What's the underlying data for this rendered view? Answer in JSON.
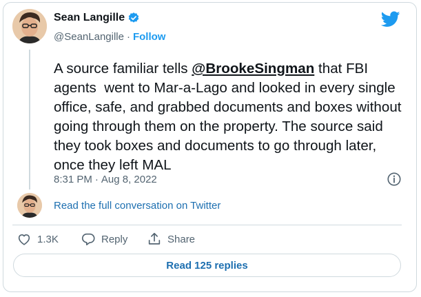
{
  "author": {
    "name": "Sean Langille",
    "handle": "@SeanLangille",
    "separator": "·",
    "follow_label": "Follow"
  },
  "tweet": {
    "text_before": "A source familiar tells ",
    "mention": "@BrookeSingman",
    "text_after": " that FBI agents  went to Mar-a-Lago and looked in every single office, safe, and grabbed documents and boxes without going through them on the property. The source said they took boxes and documents to go through later, once they left MAL",
    "time": "8:31 PM",
    "separator": "·",
    "date": "Aug 8, 2022"
  },
  "conversation_link": "Read the full conversation on Twitter",
  "actions": {
    "likes": "1.3K",
    "reply_label": "Reply",
    "share_label": "Share"
  },
  "read_replies_label": "Read 125 replies",
  "colors": {
    "brand": "#1d9bf0",
    "link": "#1d6fb0",
    "text": "#0f1419",
    "muted": "#536471",
    "border": "#cfd9de"
  },
  "icons": [
    "verified-badge-icon",
    "twitter-bird-icon",
    "info-icon",
    "heart-icon",
    "reply-icon",
    "share-icon"
  ]
}
